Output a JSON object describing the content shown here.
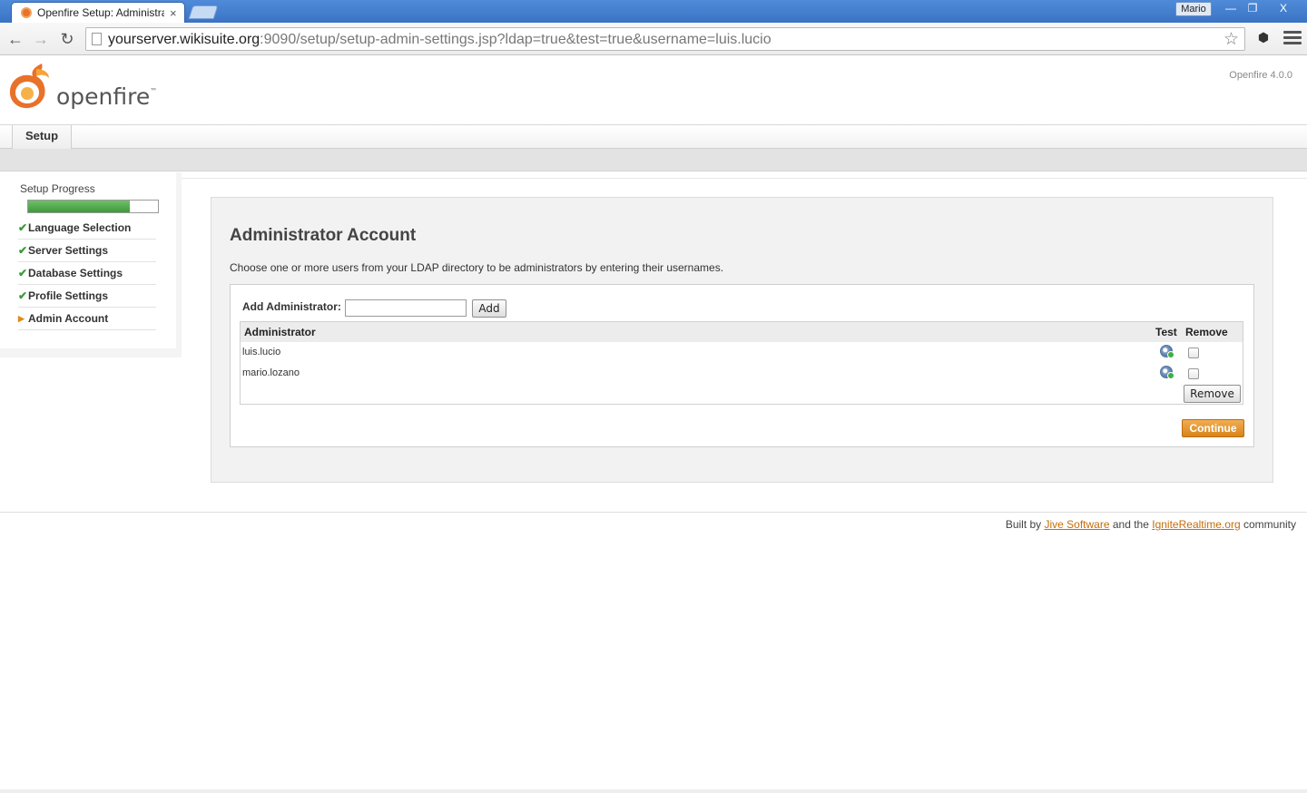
{
  "browser": {
    "tab_title": "Openfire Setup: Administrato",
    "tab_close": "×",
    "user_badge": "Mario",
    "window": {
      "minimize": "—",
      "maximize": "❐",
      "close": "X"
    },
    "nav": {
      "back": "←",
      "forward": "→",
      "reload": "↻"
    },
    "url_host": "yourserver.wikisuite.org",
    "url_rest": ":9090/setup/setup-admin-settings.jsp?ldap=true&test=true&username=luis.lucio",
    "bookmark_star": "☆",
    "extension_icon": "⬢"
  },
  "header": {
    "brand": "openfire",
    "brand_tm": "™",
    "version": "Openfire 4.0.0",
    "tabs": [
      {
        "label": "Setup"
      }
    ]
  },
  "sidebar": {
    "progress_label": "Setup Progress",
    "progress_fraction": 0.78,
    "steps": [
      {
        "label": "Language Selection",
        "mark": "✔",
        "status": "done"
      },
      {
        "label": "Server Settings",
        "mark": "✔",
        "status": "done"
      },
      {
        "label": "Database Settings",
        "mark": "✔",
        "status": "done"
      },
      {
        "label": "Profile Settings",
        "mark": "✔",
        "status": "done"
      },
      {
        "label": "Admin Account",
        "mark": "▶",
        "status": "current"
      }
    ]
  },
  "main": {
    "title": "Administrator Account",
    "description": "Choose one or more users from your LDAP directory to be administrators by entering their usernames.",
    "add_label": "Add Administrator:",
    "add_input_value": "",
    "add_button": "Add",
    "table": {
      "headers": {
        "administrator": "Administrator",
        "test": "Test",
        "remove": "Remove"
      },
      "rows": [
        {
          "name": "luis.lucio",
          "remove_checked": false
        },
        {
          "name": "mario.lozano",
          "remove_checked": false
        }
      ]
    },
    "remove_button": "Remove",
    "continue_button": "Continue"
  },
  "footer": {
    "prefix": "Built by ",
    "link1": "Jive Software",
    "middle": " and the ",
    "link2": "IgniteRealtime.org",
    "suffix": " community"
  },
  "colors": {
    "accent": "#e08a1e",
    "progress": "#4caa47",
    "link": "#c46d0b",
    "titlebar": "#3b73c4"
  }
}
